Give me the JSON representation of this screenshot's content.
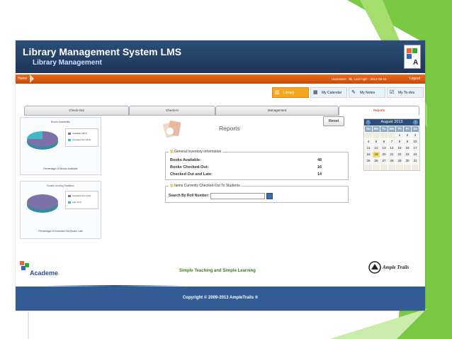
{
  "header": {
    "title": "Library Management System LMS",
    "subtitle": "Library Management"
  },
  "topbar": {
    "home_label": "Home",
    "user_info": "Username : lib, Last login : 2013-08-16",
    "logout_label": "Logout"
  },
  "nav": {
    "buttons": [
      {
        "label": "Library",
        "icon": "books-icon"
      },
      {
        "label": "My Calendar",
        "icon": "calendar-icon"
      },
      {
        "label": "My Notes",
        "icon": "notes-icon"
      },
      {
        "label": "My To-dos",
        "icon": "todo-icon"
      }
    ]
  },
  "tabs": [
    {
      "label": "Check-Out"
    },
    {
      "label": "Check-In"
    },
    {
      "label": "Management"
    },
    {
      "label": "Reports",
      "active": true
    }
  ],
  "left_panels": {
    "availability": {
      "title": "Books Availability",
      "legend": [
        "Available (48.0)",
        "Checked Out (16.0)"
      ],
      "footer": "Percentage Of Books Available",
      "chart_data": {
        "type": "pie",
        "categories": [
          "Available",
          "Checked Out"
        ],
        "values": [
          48,
          16
        ],
        "colors": [
          "#7b71a8",
          "#40b8c8"
        ]
      }
    },
    "lending": {
      "title": "Books Lending Statistics",
      "legend": [
        "Checked Out (14.0)",
        "Late (0.0)"
      ],
      "footer": "Percentage Of Checked Out Books Late",
      "chart_data": {
        "type": "pie",
        "categories": [
          "Checked Out",
          "Late"
        ],
        "values": [
          14,
          0
        ],
        "colors": [
          "#7b71a8",
          "#40b8c8"
        ]
      }
    }
  },
  "reports": {
    "title": "Reports",
    "reset_label": "Reset",
    "inventory": {
      "legend": "General Inventory Information",
      "rows": [
        {
          "label": "Books Available:",
          "value": "48"
        },
        {
          "label": "Books Checked-Out:",
          "value": "16"
        },
        {
          "label": "Checked Out and Late:",
          "value": "14"
        }
      ]
    },
    "students": {
      "legend": "Items Currently Checked-Out To Students",
      "search_label": "Search By Roll Number:",
      "search_value": ""
    }
  },
  "calendar": {
    "month_label": "August 2013",
    "days_of_week": [
      "Su",
      "Mo",
      "Tu",
      "We",
      "Th",
      "Fr",
      "Sa"
    ],
    "weeks": [
      [
        "",
        "",
        "",
        "",
        "1",
        "2",
        "3"
      ],
      [
        "4",
        "5",
        "6",
        "7",
        "8",
        "9",
        "10"
      ],
      [
        "11",
        "12",
        "13",
        "14",
        "15",
        "16",
        "17"
      ],
      [
        "18",
        "19",
        "20",
        "21",
        "22",
        "23",
        "24"
      ],
      [
        "25",
        "26",
        "27",
        "28",
        "29",
        "30",
        "31"
      ],
      [
        "",
        "",
        "",
        "",
        "",
        "",
        ""
      ]
    ],
    "today": "19"
  },
  "footer": {
    "academe_label": "Academe",
    "tagline": "Simple Teaching and Simple Learning",
    "ample_label": "Ample Trails",
    "copyright": "Copyright © 2009-2013 AmpleTrails ®"
  },
  "colors": {
    "header_blue": "#2d4e79",
    "orange_bar": "#e0600f",
    "active_nav": "#f5a623",
    "green_accent": "#7ac943",
    "pie_purple": "#7b71a8",
    "pie_teal": "#40b8c8"
  }
}
